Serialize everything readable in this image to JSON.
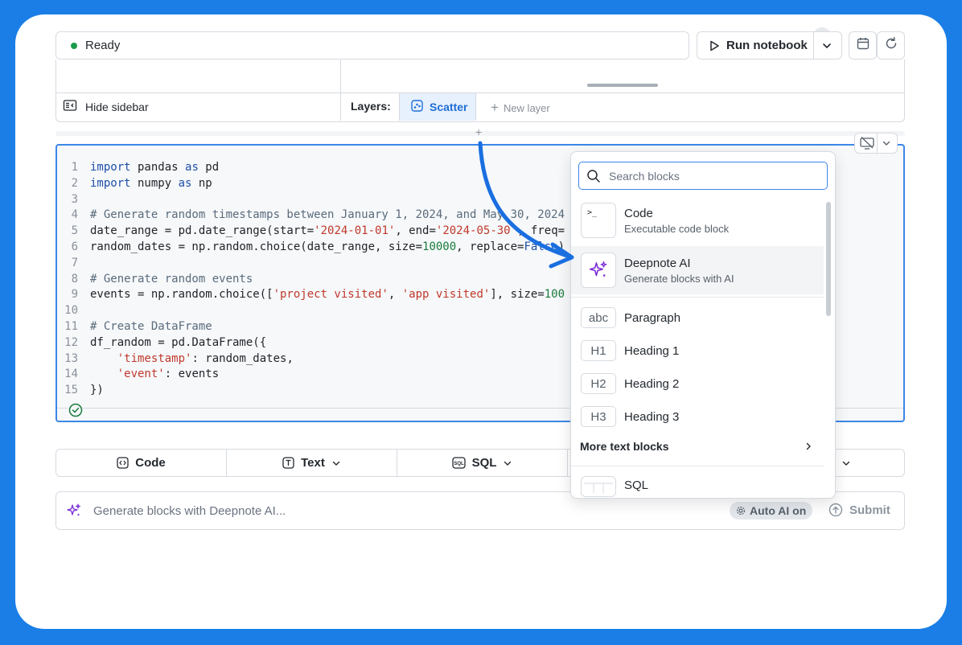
{
  "toolbar": {
    "status": "Ready",
    "run_label": "Run notebook"
  },
  "sidebar": {
    "hide_label": "Hide sidebar",
    "layers_label": "Layers:",
    "active_layer": "Scatter",
    "new_layer": "New layer"
  },
  "editor": {
    "lines": [
      "1",
      "2",
      "3",
      "4",
      "5",
      "6",
      "7",
      "8",
      "9",
      "10",
      "11",
      "12",
      "13",
      "14",
      "15"
    ]
  },
  "blockbar": {
    "code": "Code",
    "text": "Text",
    "sql": "SQL"
  },
  "ai": {
    "placeholder": "Generate blocks with Deepnote AI...",
    "auto": "Auto AI on",
    "submit": "Submit"
  },
  "menu": {
    "search_placeholder": "Search blocks",
    "items": [
      {
        "title": "Code",
        "subtitle": "Executable code block",
        "icon": ">_"
      },
      {
        "title": "Deepnote AI",
        "subtitle": "Generate blocks with AI",
        "icon": "sparkle-icon"
      },
      {
        "title": "Paragraph",
        "icon": "abc"
      },
      {
        "title": "Heading 1",
        "icon": "H1"
      },
      {
        "title": "Heading 2",
        "icon": "H2"
      },
      {
        "title": "Heading 3",
        "icon": "H3"
      }
    ],
    "more": "More text blocks",
    "sql": "SQL"
  },
  "colors": {
    "accent": "#3b87e8",
    "background": "#1a7ee6",
    "ready_dot": "#1a9b4b",
    "ai_purple": "#7b2cd6"
  }
}
